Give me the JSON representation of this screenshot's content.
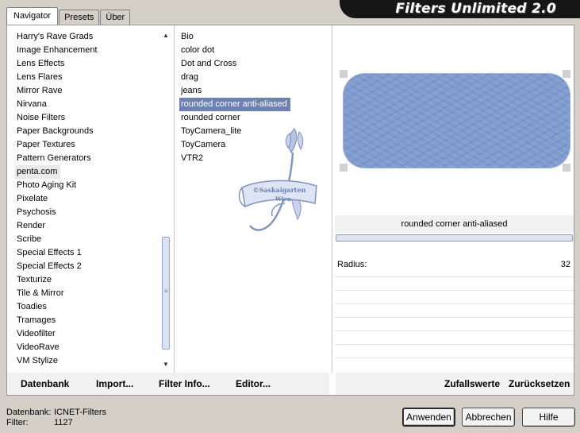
{
  "tabs": [
    {
      "label": "Navigator",
      "active": true
    },
    {
      "label": "Presets",
      "active": false
    },
    {
      "label": "Über",
      "active": false
    }
  ],
  "banner": {
    "title": "Filters Unlimited 2.0"
  },
  "categories": {
    "items": [
      "Harry's Rave Grads",
      "Image Enhancement",
      "Lens Effects",
      "Lens Flares",
      "Mirror Rave",
      "Nirvana",
      "Noise Filters",
      "Paper Backgrounds",
      "Paper Textures",
      "Pattern Generators",
      "penta.com",
      "Photo Aging Kit",
      "Pixelate",
      "Psychosis",
      "Render",
      "Scribe",
      "Special Effects 1",
      "Special Effects 2",
      "Texturize",
      "Tile & Mirror",
      "Toadies",
      "Tramages",
      "Videofilter",
      "VideoRave",
      "VM Stylize"
    ],
    "selected": "penta.com"
  },
  "filters": {
    "items": [
      "Bio",
      "color dot",
      "Dot and Cross",
      "drag",
      "jeans",
      "rounded corner anti-aliased",
      "rounded corner",
      "ToyCamera_lite",
      "ToyCamera",
      "VTR2"
    ],
    "selected": "rounded corner anti-aliased"
  },
  "watermark": {
    "line1": "©Saskaigarten",
    "line2": "Wien"
  },
  "preview": {
    "filter_name": "rounded corner anti-aliased",
    "shape_color": "#7f9ccf"
  },
  "params": {
    "radius_label": "Radius:",
    "radius_value": "32"
  },
  "links": {
    "datenbank": "Datenbank",
    "import": "Import...",
    "filter_info": "Filter Info...",
    "editor": "Editor...",
    "zufallswerte": "Zufallswerte",
    "zuruecksetzen": "Zurücksetzen"
  },
  "info": {
    "datenbank_label": "Datenbank:",
    "datenbank_value": "ICNET-Filters",
    "filter_label": "Filter:",
    "filter_value": "1127"
  },
  "buttons": {
    "apply": "Anwenden",
    "cancel": "Abbrechen",
    "help": "Hilfe"
  },
  "colors": {
    "selection": "#6b82b6",
    "banner": "#161616"
  }
}
